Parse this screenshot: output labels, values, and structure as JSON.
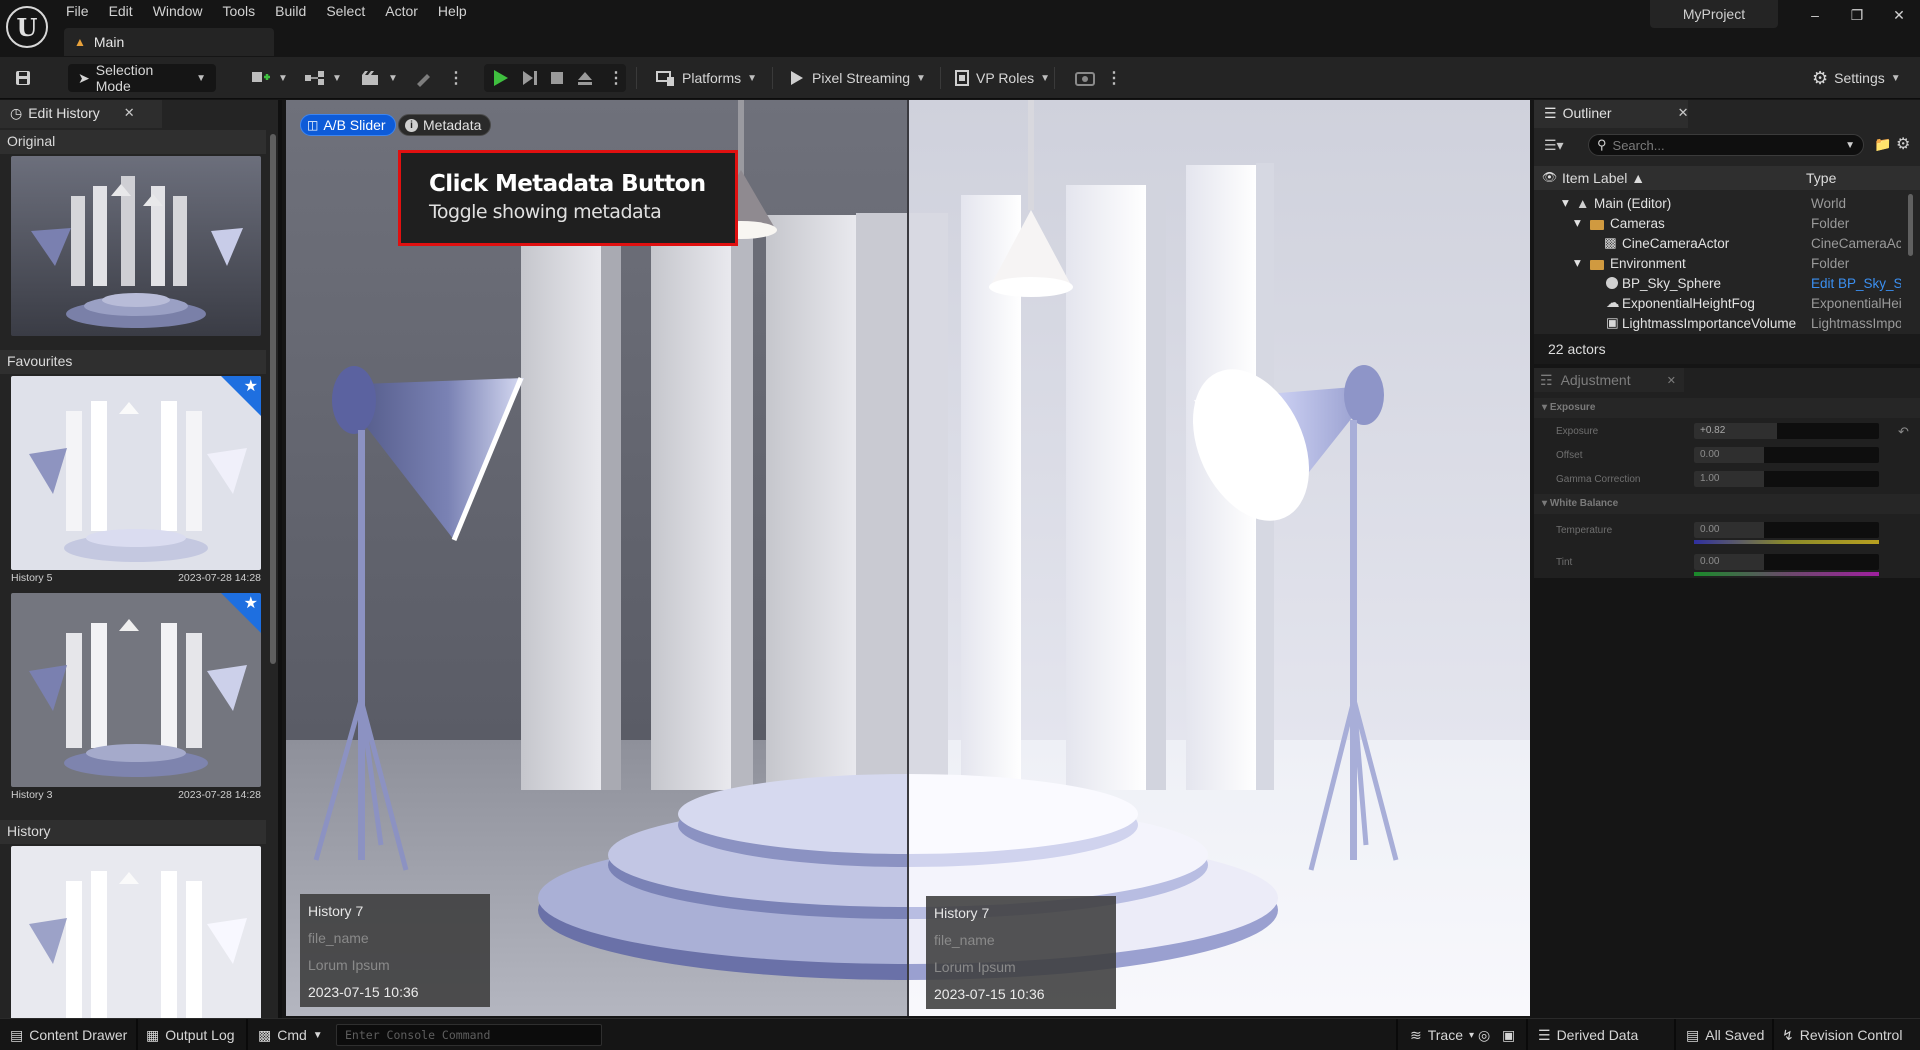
{
  "app": {
    "menu": [
      "File",
      "Edit",
      "Window",
      "Tools",
      "Build",
      "Select",
      "Actor",
      "Help"
    ],
    "level_tab": "Main",
    "project_name": "MyProject"
  },
  "toolbar": {
    "selection_mode": "Selection Mode",
    "platforms": "Platforms",
    "pixel_streaming": "Pixel Streaming",
    "vp_roles": "VP Roles",
    "settings": "Settings",
    "play_color": "#3fbf3f"
  },
  "edit_history": {
    "tab_label": "Edit History",
    "original_label": "Original",
    "favourites_label": "Favourites",
    "history_label": "History",
    "favourites": [
      {
        "name": "History 5",
        "date": "2023-07-28 14:28"
      },
      {
        "name": "History 3",
        "date": "2023-07-28 14:28"
      }
    ]
  },
  "viewport": {
    "ab_slider_label": "A/B Slider",
    "metadata_label": "Metadata",
    "callout": {
      "title": "Click Metadata Button",
      "subtitle": "Toggle showing metadata",
      "border_color": "#e01010"
    },
    "left_card": {
      "title": "History 7",
      "file_name": "file_name",
      "description": "Lorum Ipsum",
      "date": "2023-07-15 10:36"
    },
    "right_card": {
      "title": "History 7",
      "file_name": "file_name",
      "description": "Lorum Ipsum",
      "date": "2023-07-15 10:36"
    }
  },
  "outliner": {
    "tab_label": "Outliner",
    "search_placeholder": "Search...",
    "col_label": "Item Label",
    "col_type": "Type",
    "rows": [
      {
        "label": "Main (Editor)",
        "type": "World"
      },
      {
        "label": "Cameras",
        "type": "Folder"
      },
      {
        "label": "CineCameraActor",
        "type": "CineCameraAc"
      },
      {
        "label": "Environment",
        "type": "Folder"
      },
      {
        "label": "BP_Sky_Sphere",
        "type": "Edit BP_Sky_S"
      },
      {
        "label": "ExponentialHeightFog",
        "type": "ExponentialHei"
      },
      {
        "label": "LightmassImportanceVolume",
        "type": "LightmassImpo"
      }
    ],
    "footer": "22 actors"
  },
  "adjustment": {
    "tab_label": "Adjustment",
    "group_exposure": "Exposure",
    "group_white_balance": "White Balance",
    "rows": [
      {
        "name": "Exposure",
        "value": "+0.82",
        "fraction": 0.45
      },
      {
        "name": "Offset",
        "value": "0.00",
        "fraction": 0.38
      },
      {
        "name": "Gamma Correction",
        "value": "1.00",
        "fraction": 0.38
      },
      {
        "name": "Temperature",
        "value": "0.00",
        "fraction": 0.38
      },
      {
        "name": "Tint",
        "value": "0.00",
        "fraction": 0.38
      }
    ]
  },
  "statusbar": {
    "content_drawer": "Content Drawer",
    "output_log": "Output Log",
    "cmd": "Cmd",
    "console_placeholder": "Enter Console Command",
    "trace": "Trace",
    "derived_data": "Derived Data",
    "all_saved": "All Saved",
    "revision_control": "Revision Control"
  }
}
